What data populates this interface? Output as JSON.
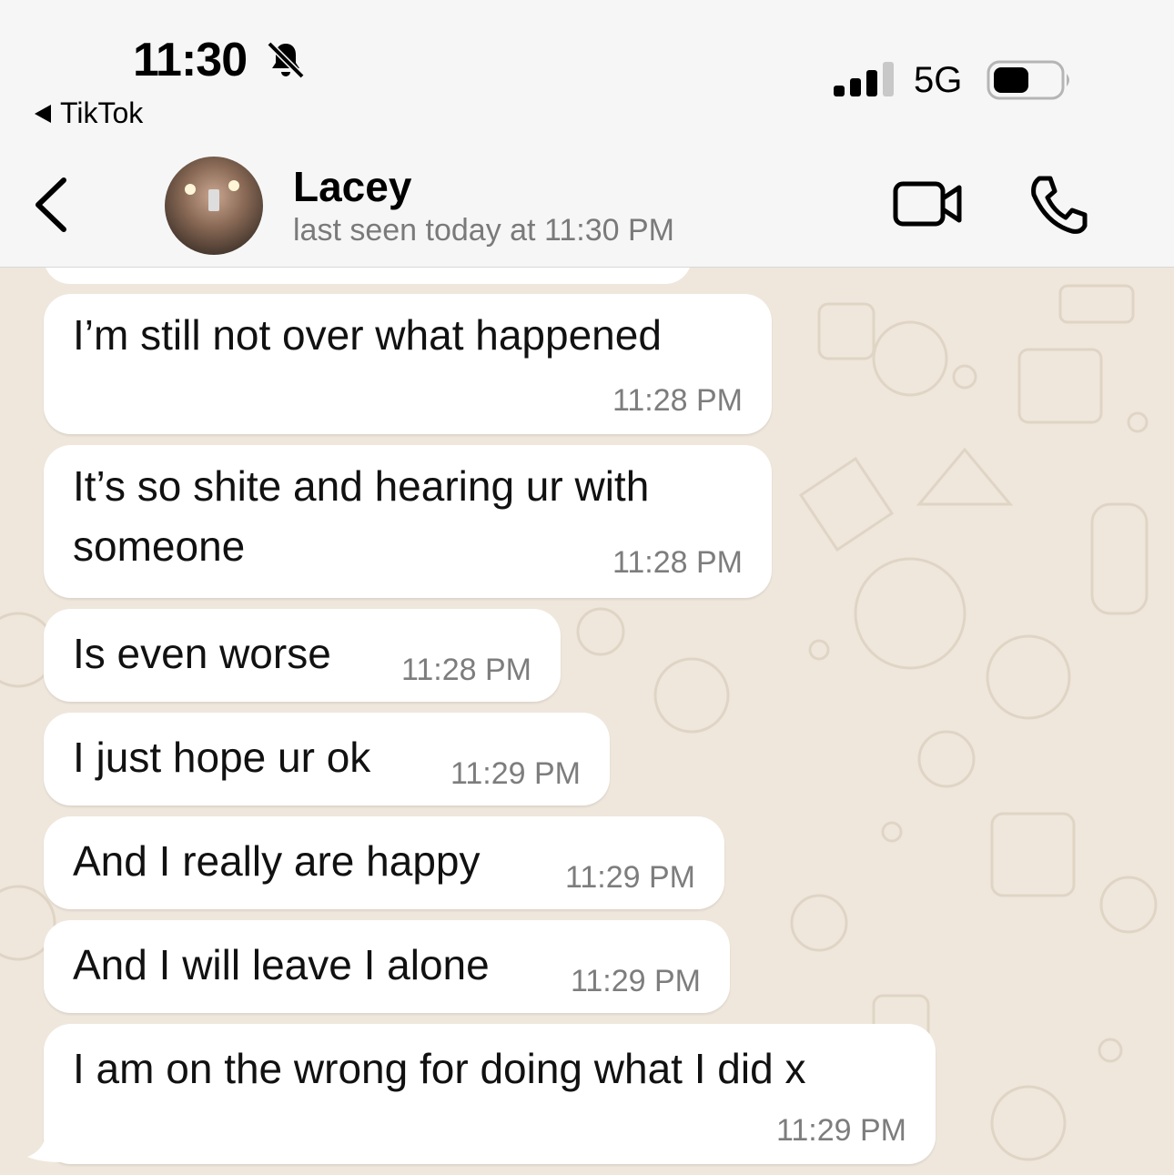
{
  "status_bar": {
    "time": "11:30",
    "back_app": "TikTok",
    "network": "5G",
    "icons": [
      "bell-muted-icon",
      "signal-icon",
      "battery-icon"
    ]
  },
  "header": {
    "contact_name": "Lacey",
    "last_seen": "last seen today at 11:30 PM",
    "icons": [
      "back-chevron-icon",
      "video-call-icon",
      "voice-call-icon"
    ]
  },
  "messages": [
    {
      "text": "I’m still not over what happened",
      "time": "11:28 PM"
    },
    {
      "text": "It’s so shite and hearing ur with",
      "text2": "someone",
      "time": "11:28 PM"
    },
    {
      "text": "Is even worse",
      "time": "11:28 PM"
    },
    {
      "text": "I just hope ur ok",
      "time": "11:29 PM"
    },
    {
      "text": "And I really are happy",
      "time": "11:29 PM"
    },
    {
      "text": "And I will leave I alone",
      "time": "11:29 PM"
    },
    {
      "text": "I am on the wrong for doing what I did x",
      "time": "11:29 PM"
    }
  ],
  "colors": {
    "chat_background": "#efe7dc",
    "bubble": "#ffffff",
    "timestamp": "#7d7d7d"
  }
}
